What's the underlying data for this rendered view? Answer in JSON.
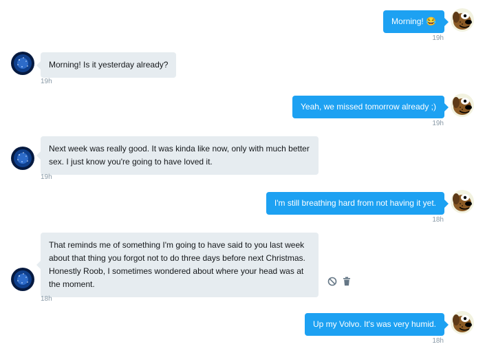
{
  "messages": [
    {
      "text": "Morning! 😂",
      "time": "19h"
    },
    {
      "text": "Morning! Is it yesterday already?",
      "time": "19h"
    },
    {
      "text": "Yeah, we missed tomorrow already ;)",
      "time": "19h"
    },
    {
      "text": "Next week was really good. It was kinda like now, only with much better sex. I just know you're going to have loved it.",
      "time": "19h"
    },
    {
      "text": "I'm still breathing hard from not having it yet.",
      "time": "18h"
    },
    {
      "text": "That reminds me of something I'm going to have said to you last week about that thing you forgot not to do three days before next Christmas. Honestly Roob, I sometimes wondered about where your head was at the moment.",
      "time": "18h"
    },
    {
      "text": "Up my Volvo. It's was very humid.",
      "time": "18h"
    }
  ],
  "colors": {
    "outgoing": "#1da1f2",
    "incoming": "#e6ecf0",
    "timestamp": "#8899a6"
  },
  "icons": {
    "outgoing_avatar": "cartoon-dog-avatar",
    "incoming_avatar": "blue-sparkle-avatar",
    "actions": [
      "block-icon",
      "trash-icon"
    ]
  }
}
